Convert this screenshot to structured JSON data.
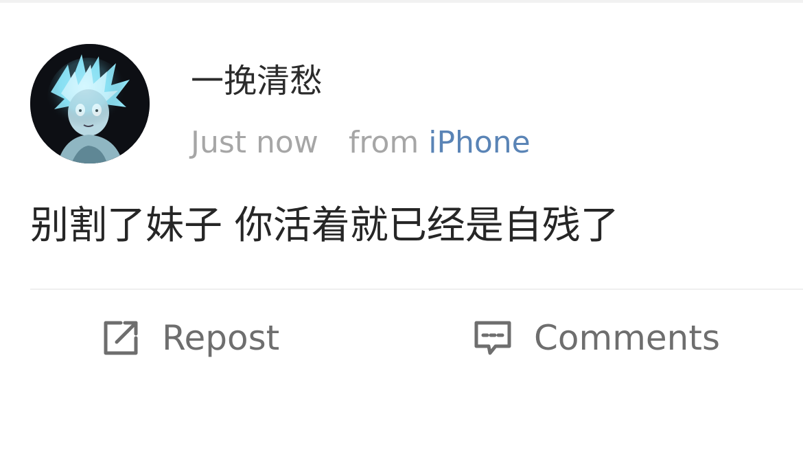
{
  "post": {
    "username": "一挽清愁",
    "time": "Just now",
    "source_prefix": "from",
    "source": "iPhone",
    "content": "别割了妹子 你活着就已经是自残了",
    "avatar_icon": "anime-avatar"
  },
  "actions": {
    "repost_label": "Repost",
    "repost_icon": "repost-icon",
    "comments_label": "Comments",
    "comments_icon": "comment-icon"
  },
  "colors": {
    "username": "#2b2b2b",
    "meta": "#a6a6a6",
    "source_link": "#5a84b6",
    "content": "#262626",
    "action": "#6e6e6e",
    "divider": "#efefef"
  }
}
